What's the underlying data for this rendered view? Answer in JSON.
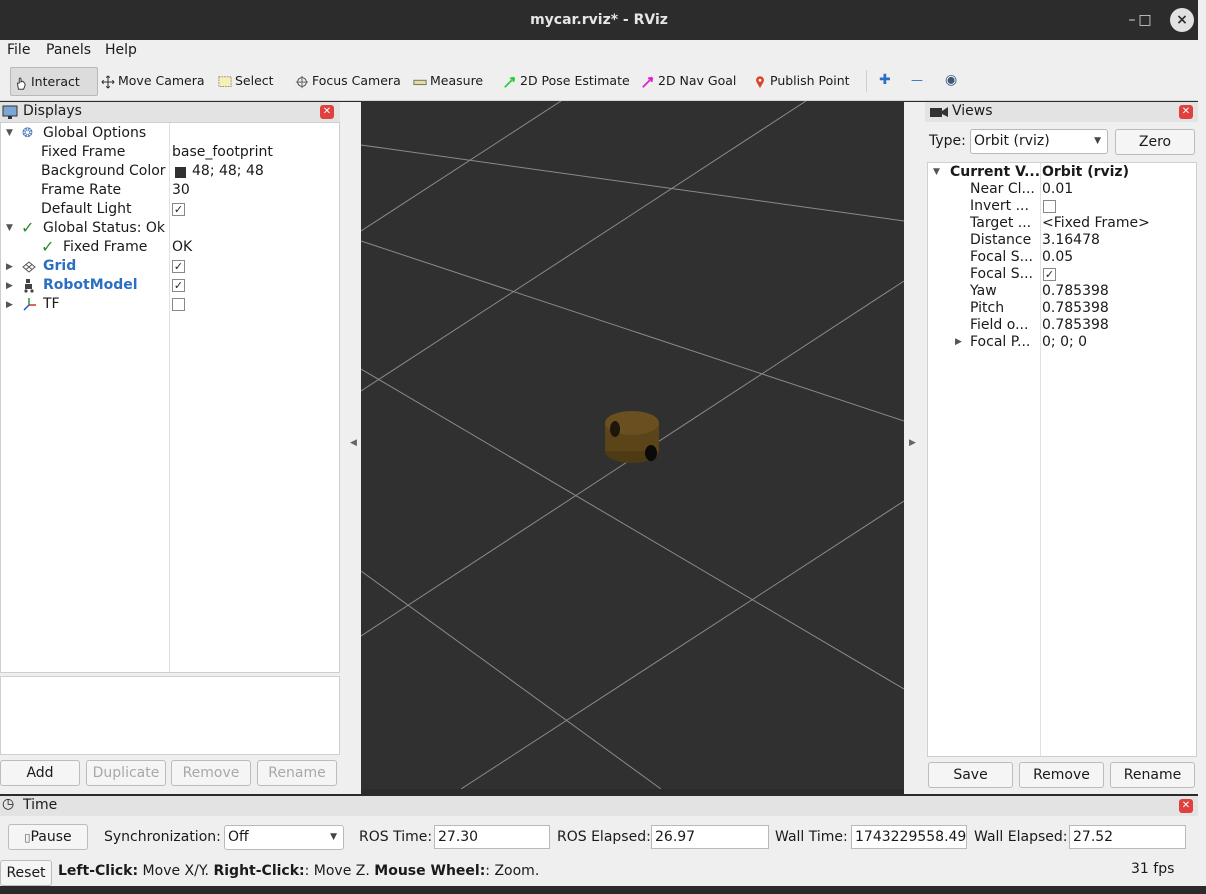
{
  "window": {
    "title": "mycar.rviz* - RViz",
    "min": "–",
    "max": "□",
    "close": "×"
  },
  "menu": [
    "File",
    "Panels",
    "Help"
  ],
  "toolbar": {
    "interact": "Interact",
    "move_camera": "Move Camera",
    "select": "Select",
    "focus_camera": "Focus Camera",
    "measure": "Measure",
    "pose_estimate": "2D Pose Estimate",
    "nav_goal": "2D Nav Goal",
    "publish_point": "Publish Point",
    "plus": "✚",
    "minus": "—",
    "eye": "◉"
  },
  "displays": {
    "title": "Displays",
    "global_options": "Global Options",
    "fixed_frame_label": "Fixed Frame",
    "fixed_frame_value": "base_footprint",
    "bg_color_label": "Background Color",
    "bg_color_value": "48; 48; 48",
    "bg_color_hex": "#303030",
    "frame_rate_label": "Frame Rate",
    "frame_rate_value": "30",
    "default_light_label": "Default Light",
    "global_status": "Global Status: Ok",
    "status_fixed_frame": "Fixed Frame",
    "status_fixed_frame_value": "OK",
    "grid": "Grid",
    "robot_model": "RobotModel",
    "tf": "TF",
    "buttons": {
      "add": "Add",
      "duplicate": "Duplicate",
      "remove": "Remove",
      "rename": "Rename"
    }
  },
  "views": {
    "title": "Views",
    "type_label": "Type:",
    "type_value": "Orbit (rviz)",
    "zero": "Zero",
    "rows": [
      {
        "name": "Current V...",
        "value": "Orbit (rviz)"
      },
      {
        "name": "Near Cl...",
        "value": "0.01"
      },
      {
        "name": "Invert ...",
        "value": ""
      },
      {
        "name": "Target ...",
        "value": "<Fixed Frame>"
      },
      {
        "name": "Distance",
        "value": "3.16478"
      },
      {
        "name": "Focal S...",
        "value": "0.05"
      },
      {
        "name": "Focal S...",
        "value": ""
      },
      {
        "name": "Yaw",
        "value": "0.785398"
      },
      {
        "name": "Pitch",
        "value": "0.785398"
      },
      {
        "name": "Field o...",
        "value": "0.785398"
      },
      {
        "name": "Focal P...",
        "value": "0; 0; 0"
      }
    ],
    "buttons": {
      "save": "Save",
      "remove": "Remove",
      "rename": "Rename"
    }
  },
  "time": {
    "title": "Time",
    "pause": "Pause",
    "sync_label": "Synchronization:",
    "sync_value": "Off",
    "ros_time_label": "ROS Time:",
    "ros_time": "27.30",
    "ros_elapsed_label": "ROS Elapsed:",
    "ros_elapsed": "26.97",
    "wall_time_label": "Wall Time:",
    "wall_time": "1743229558.49",
    "wall_elapsed_label": "Wall Elapsed:",
    "wall_elapsed": "27.52"
  },
  "status": {
    "reset": "Reset",
    "left_click": "Left-Click:",
    "left_action": " Move X/Y. ",
    "right_click": "Right-Click:",
    "right_action": ": Move Z. ",
    "wheel": "Mouse Wheel:",
    "wheel_action": ": Zoom.",
    "fps": "31 fps"
  },
  "colors": {
    "accent_blue": "#2c6fc2",
    "robot_body": "#5a4418",
    "grid_line": "#8a8a8a"
  }
}
